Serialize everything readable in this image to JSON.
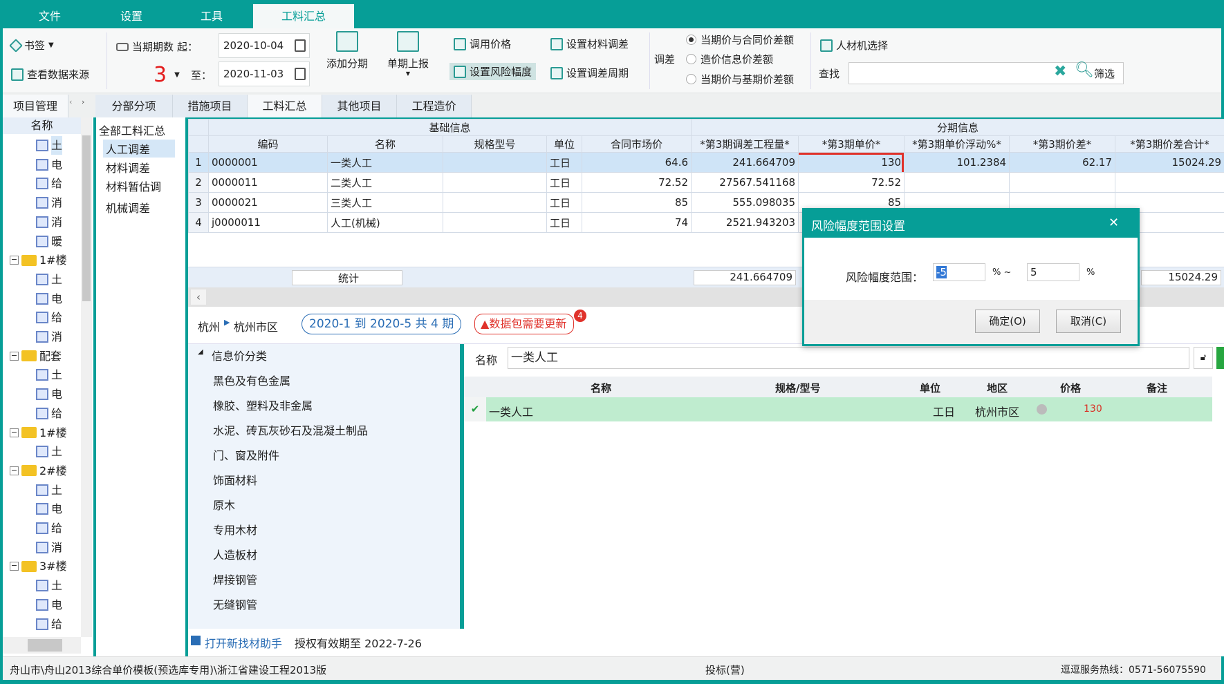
{
  "menu": {
    "tabs": [
      "文件",
      "设置",
      "工具",
      "工料汇总"
    ],
    "active": "工料汇总"
  },
  "ribbon": {
    "bookmark": "书签",
    "view_source": "查看数据来源",
    "period_label": "当期期数",
    "period_value": "3",
    "start_label": "起：",
    "start_date": "2020-10-04",
    "end_label": "至：",
    "end_date": "2020-11-03",
    "add_period": "添加分期",
    "single_report": "单期上报",
    "use_price": "调用价格",
    "set_risk": "设置风险幅度",
    "set_material_adjust": "设置材料调差",
    "set_adjust_period": "设置调差周期",
    "adjust_label": "调差",
    "radios": [
      {
        "label": "当期价与合同价差额",
        "checked": true
      },
      {
        "label": "造价信息价差额",
        "checked": false
      },
      {
        "label": "当期价与基期价差额",
        "checked": false
      }
    ],
    "rcj_select": "人材机选择",
    "search_label": "查找",
    "search_value": "",
    "filter": "筛选"
  },
  "subtabs": {
    "project": "项目管理",
    "tabs": [
      "分部分项",
      "措施项目",
      "工料汇总",
      "其他项目",
      "工程造价"
    ],
    "active": "工料汇总"
  },
  "tree": {
    "header": "名称",
    "rows": [
      {
        "t": "doc",
        "label": "土"
      },
      {
        "t": "doc",
        "label": "电"
      },
      {
        "t": "doc",
        "label": "给"
      },
      {
        "t": "doc",
        "label": "消"
      },
      {
        "t": "doc",
        "label": "消"
      },
      {
        "t": "doc",
        "label": "暖"
      },
      {
        "t": "folder",
        "label": "1#楼"
      },
      {
        "t": "doc",
        "label": "土"
      },
      {
        "t": "doc",
        "label": "电"
      },
      {
        "t": "doc",
        "label": "给"
      },
      {
        "t": "doc",
        "label": "消"
      },
      {
        "t": "folder",
        "label": "配套"
      },
      {
        "t": "doc",
        "label": "土"
      },
      {
        "t": "doc",
        "label": "电"
      },
      {
        "t": "doc",
        "label": "给"
      },
      {
        "t": "folder",
        "label": "1#楼"
      },
      {
        "t": "doc",
        "label": "土"
      },
      {
        "t": "folder",
        "label": "2#楼"
      },
      {
        "t": "doc",
        "label": "土"
      },
      {
        "t": "doc",
        "label": "电"
      },
      {
        "t": "doc",
        "label": "给"
      },
      {
        "t": "doc",
        "label": "消"
      },
      {
        "t": "folder",
        "label": "3#楼"
      },
      {
        "t": "doc",
        "label": "土"
      },
      {
        "t": "doc",
        "label": "电"
      },
      {
        "t": "doc",
        "label": "给"
      }
    ]
  },
  "summary_list": {
    "root": "全部工料汇总",
    "items": [
      "人工调差",
      "材料调差",
      "材料暂估调",
      "机械调差"
    ],
    "selected": "人工调差"
  },
  "main_table": {
    "group_basic": "基础信息",
    "group_period": "分期信息",
    "columns": [
      "编码",
      "名称",
      "规格型号",
      "单位",
      "合同市场价",
      "*第3期调差工程量*",
      "*第3期单价*",
      "*第3期单价浮动%*",
      "*第3期价差*",
      "*第3期价差合计*"
    ],
    "rows": [
      [
        "1",
        "0000001",
        "一类人工",
        "",
        "工日",
        "64.6",
        "241.664709",
        "130",
        "101.2384",
        "62.17",
        "15024.29"
      ],
      [
        "2",
        "0000011",
        "二类人工",
        "",
        "工日",
        "72.52",
        "27567.541168",
        "72.52",
        "",
        "",
        ""
      ],
      [
        "3",
        "0000021",
        "三类人工",
        "",
        "工日",
        "85",
        "555.098035",
        "85",
        "",
        "",
        ""
      ],
      [
        "4",
        "j0000011",
        "人工(机械)",
        "",
        "工日",
        "74",
        "2521.943203",
        "",
        "",
        "",
        ""
      ]
    ],
    "stat_label": "统计",
    "stat_qty": "241.664709",
    "stat_total": "15024.29"
  },
  "info_bar": {
    "province": "杭州",
    "city": "杭州市区",
    "period_range": "2020-1 到 2020-5 共 4 期",
    "update_warning": "数据包需要更新",
    "update_count": "4"
  },
  "categories": {
    "root": "信息价分类",
    "items": [
      "黑色及有色金属",
      "橡胶、塑料及非金属",
      "水泥、砖瓦灰砂石及混凝土制品",
      "门、窗及附件",
      "饰面材料",
      "原木",
      "专用木材",
      "人造板材",
      "焊接钢管",
      "无缝钢管"
    ]
  },
  "price_search": {
    "name_label": "名称",
    "name_value": "一类人工",
    "columns": [
      "名称",
      "规格/型号",
      "单位",
      "地区",
      "价格",
      "备注"
    ],
    "rows": [
      [
        "一类人工",
        "",
        "工日",
        "杭州市区",
        "130",
        ""
      ]
    ]
  },
  "footer": {
    "open_helper": "打开新找材助手",
    "license": "授权有效期至 2022-7-26"
  },
  "status_bar": {
    "template": "舟山市\\舟山2013综合单价模板(预选库专用)\\浙江省建设工程2013版",
    "mode": "投标(营)",
    "hotline": "逗逗服务热线：0571-56075590"
  },
  "dialog": {
    "title": "风险幅度范围设置",
    "label": "风险幅度范围：",
    "min": "-5",
    "max": "5",
    "percent": "%",
    "tilde": "% ~",
    "ok": "确定(O)",
    "cancel": "取消(C)"
  },
  "colors": {
    "brand": "#069e97",
    "selected_row": "#cfe4f7",
    "match_row": "#bfeccf",
    "warning": "#e0322b",
    "period_badge": "#2a6db5"
  }
}
